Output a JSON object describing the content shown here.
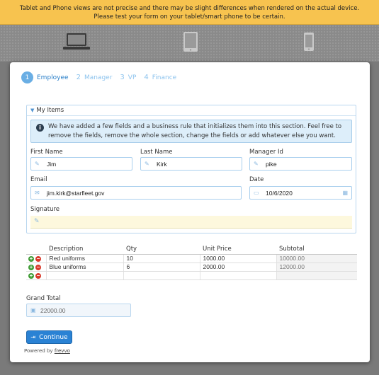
{
  "banner": {
    "line1": "Tablet and Phone views are not precise and there may be slight differences when rendered on the actual device.",
    "line2": "Please test your form on your tablet/smart phone to be certain."
  },
  "devices": [
    "desktop-icon",
    "tablet-icon",
    "phone-icon"
  ],
  "steps": [
    {
      "num": "1",
      "label": "Employee"
    },
    {
      "num": "2",
      "label": "Manager"
    },
    {
      "num": "3",
      "label": "VP"
    },
    {
      "num": "4",
      "label": "Finance"
    }
  ],
  "section": {
    "title": "My Items",
    "info": "We have added a few fields and a business rule that initializes them into this section. Feel free to remove the fields, remove the whole section, change the fields or add whatever else you want."
  },
  "fields": {
    "first_name": {
      "label": "First Name",
      "value": "Jim"
    },
    "last_name": {
      "label": "Last Name",
      "value": "Kirk"
    },
    "manager_id": {
      "label": "Manager Id",
      "value": "pike"
    },
    "email": {
      "label": "Email",
      "value": "jim.kirk@starfleet.gov"
    },
    "date": {
      "label": "Date",
      "value": "10/6/2020"
    },
    "signature": {
      "label": "Signature"
    }
  },
  "table": {
    "columns": [
      "Description",
      "Qty",
      "Unit Price",
      "Subtotal"
    ],
    "rows": [
      {
        "description": "Red uniforms",
        "qty": "10",
        "unit_price": "1000.00",
        "subtotal": "10000.00"
      },
      {
        "description": "Blue uniforms",
        "qty": "6",
        "unit_price": "2000.00",
        "subtotal": "12000.00"
      },
      {
        "description": "",
        "qty": "",
        "unit_price": "",
        "subtotal": ""
      }
    ]
  },
  "grand_total": {
    "label": "Grand Total",
    "value": "22000.00"
  },
  "continue_label": "Continue",
  "powered": {
    "prefix": "Powered by",
    "link": "frevvo"
  },
  "colors": {
    "accent": "#2a82d4",
    "banner": "#f7c34f",
    "add": "#3f9c35",
    "remove": "#d93a2b"
  }
}
